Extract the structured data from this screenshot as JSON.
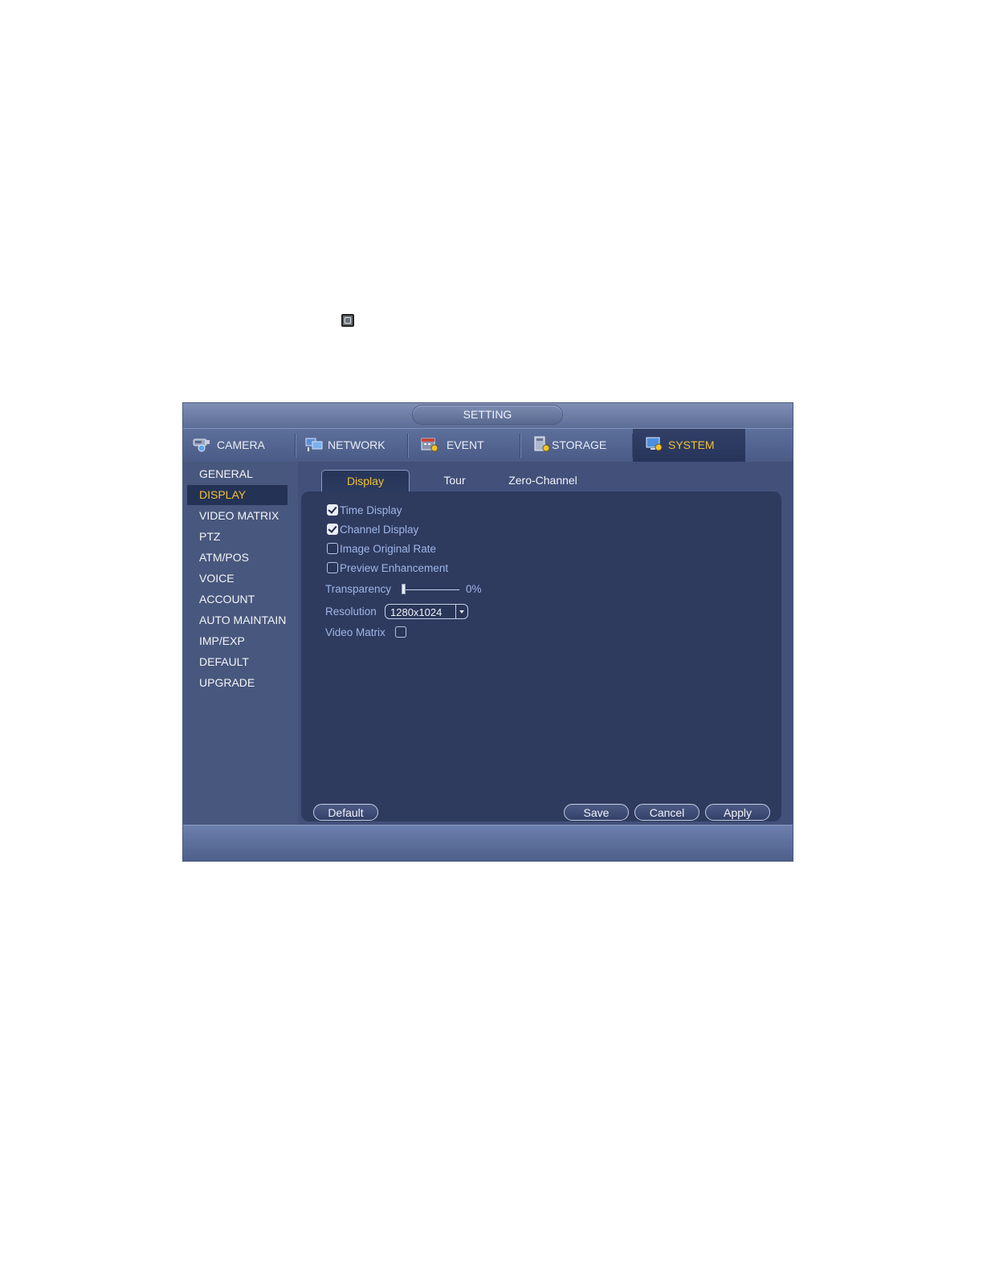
{
  "window": {
    "title": "SETTING"
  },
  "main_tabs": [
    {
      "label": "CAMERA",
      "icon": "camera-icon"
    },
    {
      "label": "NETWORK",
      "icon": "network-icon"
    },
    {
      "label": "EVENT",
      "icon": "event-icon"
    },
    {
      "label": "STORAGE",
      "icon": "storage-icon"
    },
    {
      "label": "SYSTEM",
      "icon": "system-icon",
      "active": true
    }
  ],
  "sidebar": {
    "items": [
      {
        "label": "GENERAL"
      },
      {
        "label": "DISPLAY",
        "active": true
      },
      {
        "label": "VIDEO MATRIX"
      },
      {
        "label": "PTZ"
      },
      {
        "label": "ATM/POS"
      },
      {
        "label": "VOICE"
      },
      {
        "label": "ACCOUNT"
      },
      {
        "label": "AUTO MAINTAIN"
      },
      {
        "label": "IMP/EXP"
      },
      {
        "label": "DEFAULT"
      },
      {
        "label": "UPGRADE"
      }
    ]
  },
  "sub_tabs": [
    {
      "label": "Display",
      "active": true
    },
    {
      "label": "Tour"
    },
    {
      "label": "Zero-Channel"
    }
  ],
  "display": {
    "time_display": {
      "label": "Time Display",
      "checked": true
    },
    "channel_display": {
      "label": "Channel Display",
      "checked": true
    },
    "image_original_rate": {
      "label": "Image Original Rate",
      "checked": false
    },
    "preview_enhancement": {
      "label": "Preview Enhancement",
      "checked": false
    },
    "transparency": {
      "label": "Transparency",
      "value": "0%",
      "fraction": 0
    },
    "resolution": {
      "label": "Resolution",
      "value": "1280x1024"
    },
    "video_matrix": {
      "label": "Video Matrix",
      "checked": false
    }
  },
  "buttons": {
    "default": "Default",
    "save": "Save",
    "cancel": "Cancel",
    "apply": "Apply"
  },
  "colors": {
    "active_text": "#f1c232",
    "panel_bg": "#2e3a5e",
    "window_bg": "#3c4a6e"
  }
}
